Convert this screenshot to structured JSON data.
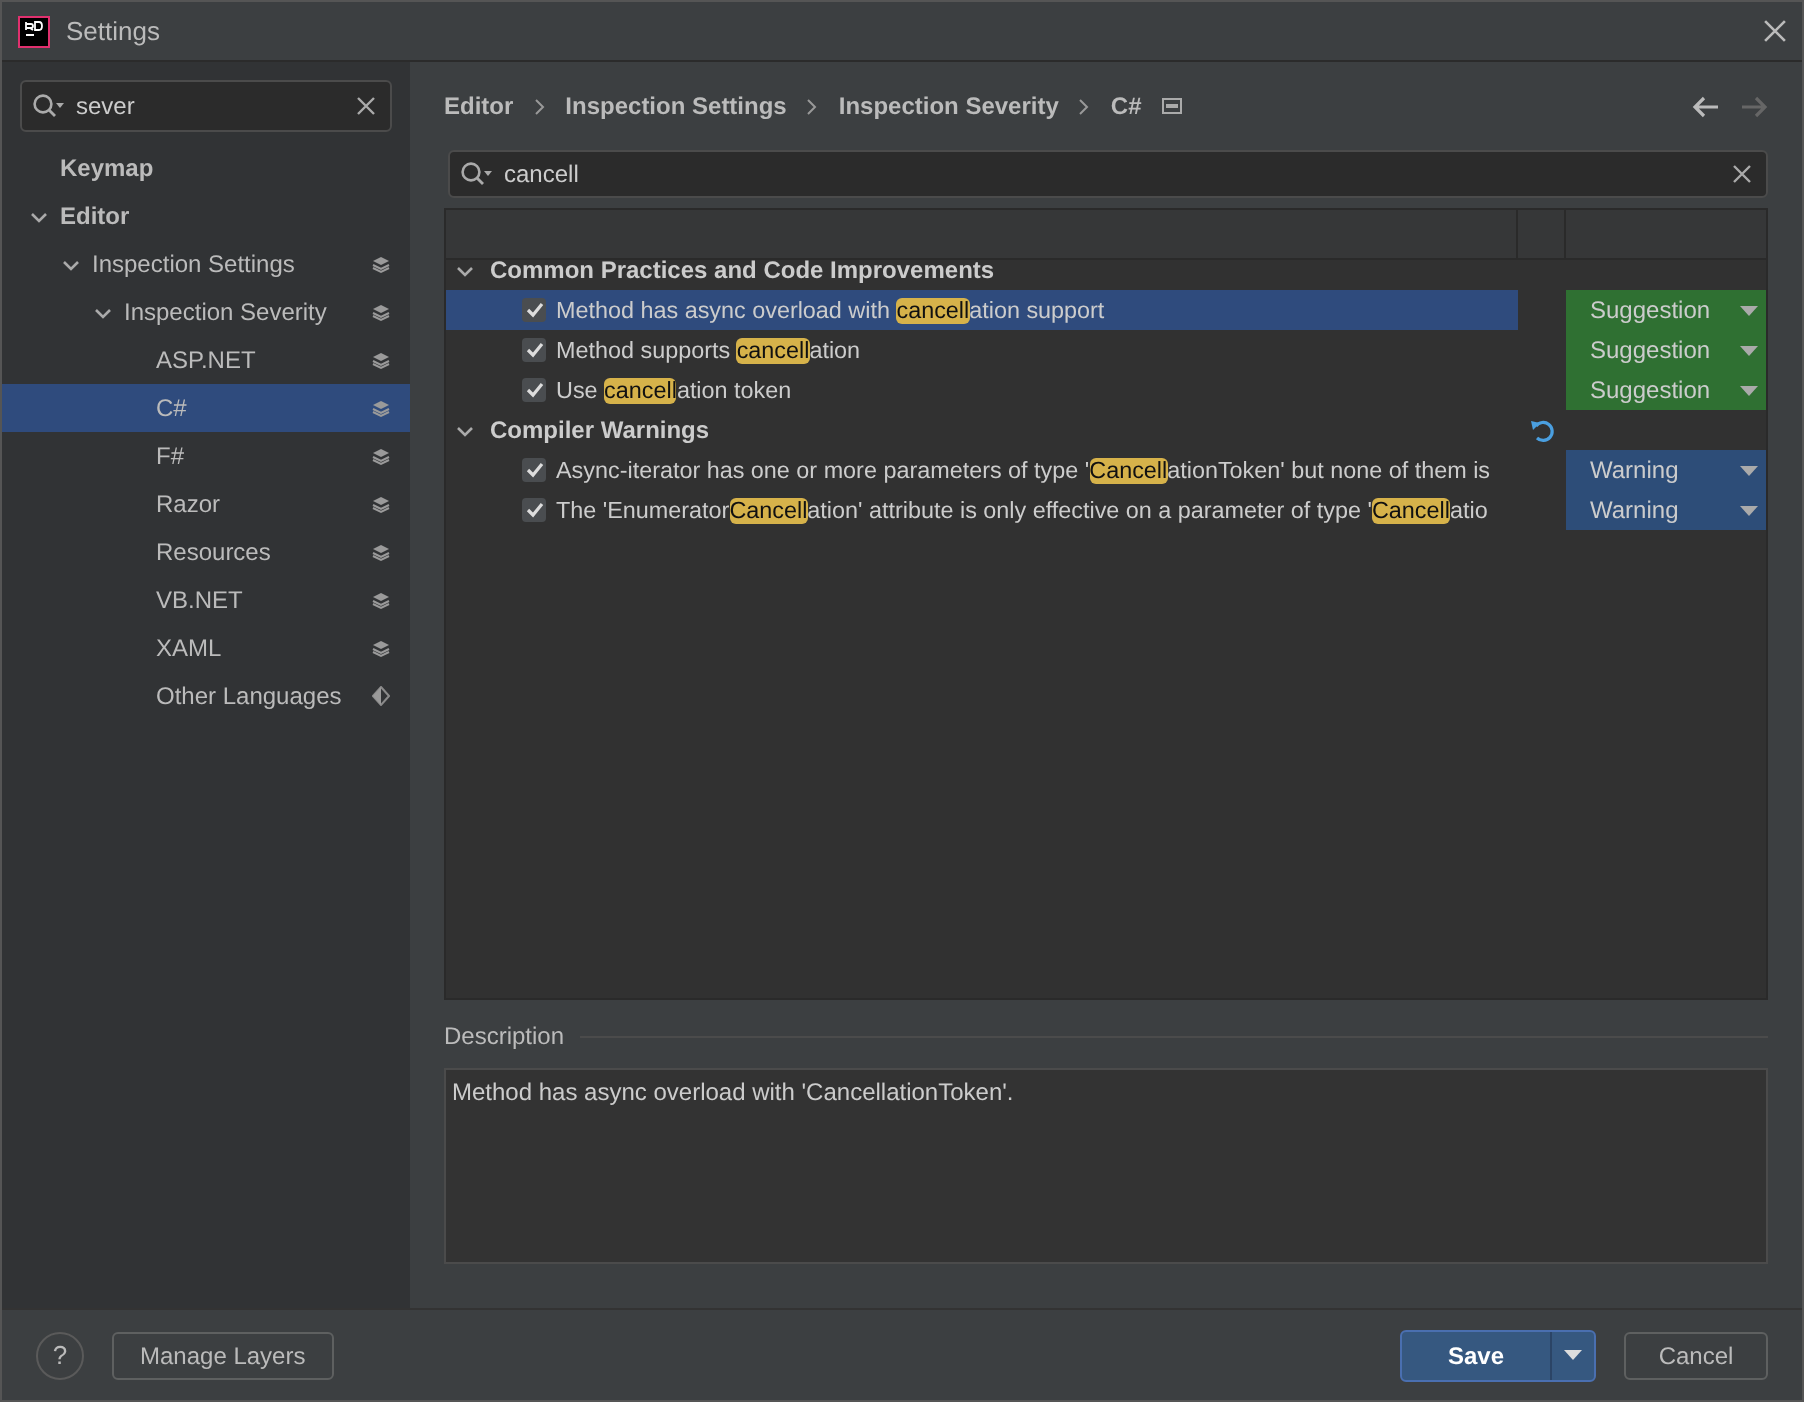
{
  "window": {
    "title": "Settings"
  },
  "sidebar": {
    "search": {
      "value": "sever"
    },
    "items": [
      {
        "label": "Keymap",
        "bold": true,
        "selected": false
      },
      {
        "label": "Editor",
        "bold": true,
        "expanded": true,
        "selected": false,
        "children": [
          {
            "label": "Inspection Settings",
            "bold": false,
            "expanded": true,
            "selected": false,
            "kind": "layers",
            "children": [
              {
                "label": "Inspection Severity",
                "bold": false,
                "expanded": true,
                "selected": false,
                "kind": "layers",
                "children": [
                  {
                    "label": "ASP.NET",
                    "selected": false,
                    "kind": "layers"
                  },
                  {
                    "label": "C#",
                    "selected": true,
                    "kind": "layers"
                  },
                  {
                    "label": "F#",
                    "selected": false,
                    "kind": "layers"
                  },
                  {
                    "label": "Razor",
                    "selected": false,
                    "kind": "layers"
                  },
                  {
                    "label": "Resources",
                    "selected": false,
                    "kind": "layers"
                  },
                  {
                    "label": "VB.NET",
                    "selected": false,
                    "kind": "layers"
                  },
                  {
                    "label": "XAML",
                    "selected": false,
                    "kind": "layers"
                  },
                  {
                    "label": "Other Languages",
                    "selected": false,
                    "kind": "partial"
                  }
                ]
              }
            ]
          }
        ]
      }
    ]
  },
  "breadcrumbs": [
    "Editor",
    "Inspection Settings",
    "Inspection Severity",
    "C#"
  ],
  "filter": {
    "value": "cancell"
  },
  "groups": [
    {
      "label": "Common Practices and Code Improvements",
      "expanded": true,
      "modified": false,
      "items": [
        {
          "segments": [
            {
              "text": "Method has async overload with ",
              "highlight": false
            },
            {
              "text": "cancell",
              "highlight": true
            },
            {
              "text": "ation support",
              "highlight": false
            }
          ],
          "checked": true,
          "selected": true,
          "severity": "Suggestion",
          "color": "#2f7032"
        },
        {
          "segments": [
            {
              "text": "Method supports ",
              "highlight": false
            },
            {
              "text": "cancell",
              "highlight": true
            },
            {
              "text": "ation",
              "highlight": false
            }
          ],
          "checked": true,
          "selected": false,
          "severity": "Suggestion",
          "color": "#2f7032"
        },
        {
          "segments": [
            {
              "text": "Use ",
              "highlight": false
            },
            {
              "text": "cancell",
              "highlight": true
            },
            {
              "text": "ation token",
              "highlight": false
            }
          ],
          "checked": true,
          "selected": false,
          "severity": "Suggestion",
          "color": "#2f7032"
        }
      ]
    },
    {
      "label": "Compiler Warnings",
      "expanded": true,
      "modified": true,
      "items": [
        {
          "segments": [
            {
              "text": "Async-iterator has one or more parameters of type '",
              "highlight": false
            },
            {
              "text": "Cancell",
              "highlight": true
            },
            {
              "text": "ationToken' but none of them is",
              "highlight": false
            }
          ],
          "checked": true,
          "selected": false,
          "severity": "Warning",
          "color": "#2d4d78"
        },
        {
          "segments": [
            {
              "text": "The 'Enumerator",
              "highlight": false
            },
            {
              "text": "Cancell",
              "highlight": true
            },
            {
              "text": "ation' attribute is only effective on a parameter of type '",
              "highlight": false
            },
            {
              "text": "Cancell",
              "highlight": true
            },
            {
              "text": "atio",
              "highlight": false
            }
          ],
          "checked": true,
          "selected": false,
          "severity": "Warning",
          "color": "#2d4d78"
        }
      ]
    }
  ],
  "description": {
    "label": "Description",
    "text": "Method has async overload with 'CancellationToken'."
  },
  "footer": {
    "help": "?",
    "manage": "Manage Layers",
    "save": "Save",
    "cancel": "Cancel"
  }
}
